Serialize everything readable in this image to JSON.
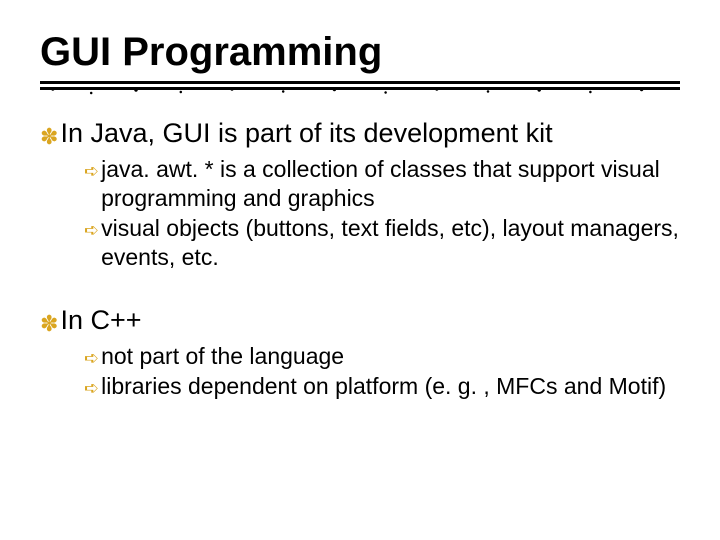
{
  "title": "GUI Programming",
  "points": [
    {
      "text": "In Java, GUI is part of its development kit",
      "sub": [
        "java. awt. * is a collection of classes that support visual programming and graphics",
        "visual objects (buttons, text fields, etc), layout managers, events, etc."
      ]
    },
    {
      "text": "In C++",
      "sub": [
        "not part of the language",
        "libraries dependent on platform (e. g. , MFCs and Motif)"
      ]
    }
  ]
}
